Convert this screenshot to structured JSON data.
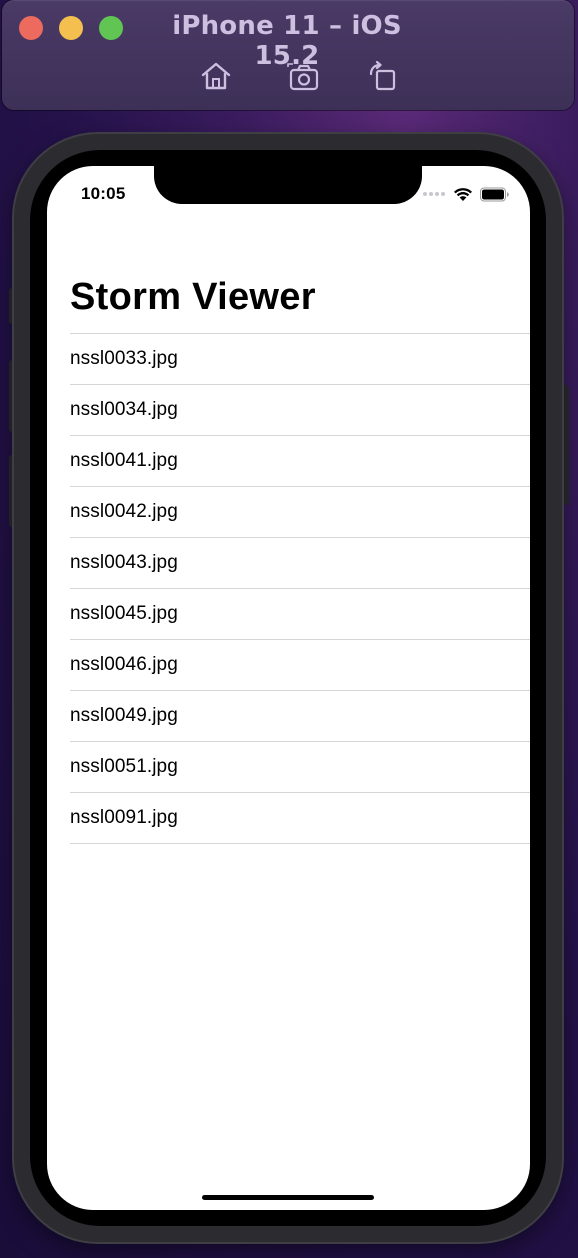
{
  "simulator": {
    "title": "iPhone 11 – iOS 15.2",
    "toolbar": [
      {
        "name": "home",
        "icon": "home-icon"
      },
      {
        "name": "screenshot",
        "icon": "screenshot-icon"
      },
      {
        "name": "rotate",
        "icon": "rotate-icon"
      }
    ],
    "window_controls": [
      "close",
      "minimize",
      "zoom"
    ]
  },
  "status_bar": {
    "time": "10:05"
  },
  "screen": {
    "title": "Storm Viewer",
    "items": [
      "nssl0033.jpg",
      "nssl0034.jpg",
      "nssl0041.jpg",
      "nssl0042.jpg",
      "nssl0043.jpg",
      "nssl0045.jpg",
      "nssl0046.jpg",
      "nssl0049.jpg",
      "nssl0051.jpg",
      "nssl0091.jpg"
    ]
  },
  "colors": {
    "close": "#ec6a5e",
    "minimize": "#f4bf4f",
    "zoom": "#61c554",
    "separator": "#d6d6da",
    "screen_bg": "#ffffff"
  }
}
